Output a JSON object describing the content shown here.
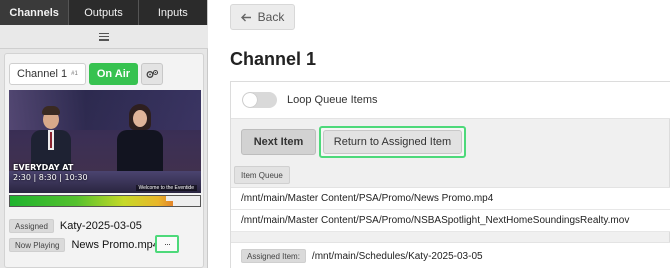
{
  "tabs": [
    {
      "label": "Channels",
      "active": true
    },
    {
      "label": "Outputs",
      "active": false
    },
    {
      "label": "Inputs",
      "active": false
    }
  ],
  "channel_card": {
    "channel_label": "Channel 1",
    "channel_number": "#1",
    "status": "On Air",
    "status_color": "#37c250",
    "video_overlay": {
      "line1": "EVERYDAY AT",
      "line2": "2:30 | 8:30 | 10:30",
      "welcome": "Welcome to the Eventide"
    },
    "assigned_label": "Assigned",
    "assigned_value": "Katy-2025-03-05",
    "now_playing_label": "Now Playing",
    "now_playing_value": "News Promo.mp4",
    "more_button": "···",
    "audio_levels": [
      0.82,
      0.86
    ]
  },
  "right": {
    "back_label": "Back",
    "title": "Channel 1",
    "loop_label": "Loop Queue Items",
    "loop_enabled": false,
    "next_item_label": "Next Item",
    "return_label": "Return to Assigned Item",
    "queue_label": "Item Queue",
    "queue": [
      "/mnt/main/Master Content/PSA/Promo/News Promo.mp4",
      "/mnt/main/Master Content/PSA/Promo/NSBASpotlight_NextHomeSoundingsRealty.mov"
    ],
    "assigned_item_label": "Assigned Item:",
    "assigned_item_value": "/mnt/main/Schedules/Katy-2025-03-05"
  },
  "colors": {
    "accent_green": "#37c250",
    "highlight_border": "#4dd97a",
    "tab_bar": "#2b2b2b"
  }
}
